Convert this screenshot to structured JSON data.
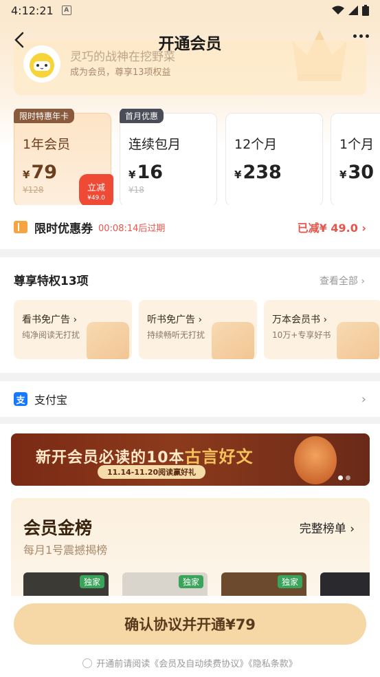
{
  "status_bar": {
    "time": "4:12:21",
    "indicator": "A"
  },
  "header": {
    "title": "开通会员"
  },
  "user": {
    "name": "灵巧的战神在挖野菜",
    "subtitle": "成为会员，尊享13项权益"
  },
  "plans": [
    {
      "tag": "限时特惠年卡",
      "name": "1年会员",
      "currency": "¥",
      "price": "79",
      "original": "¥128",
      "selected": true,
      "badge_line1": "立减",
      "badge_line2": "¥49.0"
    },
    {
      "tag": "首月优惠",
      "name": "连续包月",
      "currency": "¥",
      "price": "16",
      "original": "¥18",
      "selected": false
    },
    {
      "tag": "",
      "name": "12个月",
      "currency": "¥",
      "price": "238",
      "original": "",
      "selected": false
    },
    {
      "tag": "",
      "name": "1个月",
      "currency": "¥",
      "price": "30",
      "original": "",
      "selected": false
    }
  ],
  "coupon": {
    "label": "限时优惠券",
    "timer": "00:08:14后过期",
    "saved": "已减¥ 49.0"
  },
  "perks": {
    "title": "尊享特权13项",
    "view_all": "查看全部",
    "items": [
      {
        "title": "看书免广告",
        "subtitle": "纯净阅读无打扰",
        "icon": "ad-free-icon"
      },
      {
        "title": "听书免广告",
        "subtitle": "持续畅听无打扰",
        "icon": "headphones-icon"
      },
      {
        "title": "万本会员书",
        "subtitle": "10万+专享好书",
        "icon": "books-icon"
      }
    ]
  },
  "payment": {
    "icon_glyph": "支",
    "label": "支付宝"
  },
  "banner": {
    "title_a": "新开会员必读的10本",
    "title_b": "古言好文",
    "subtitle": "11.14-11.20阅读赢好礼"
  },
  "ranking": {
    "title": "会员金榜",
    "subtitle": "每月1号震撼揭榜",
    "more": "完整榜单",
    "covers": [
      {
        "badge": "独家",
        "color": "#3b3a35"
      },
      {
        "badge": "独家",
        "color": "#d9d4cc"
      },
      {
        "badge": "独家",
        "color": "#6b4a2e"
      },
      {
        "badge": "",
        "color": "#2a2a2e"
      }
    ]
  },
  "cta": {
    "label": "确认协议并开通¥79"
  },
  "agreement": {
    "text": "开通前请阅读《会员及自动续费协议》《隐私条款》"
  },
  "colors": {
    "accent": "#e9544a",
    "gold": "#f6d7a6",
    "brand_brown": "#6b3e1e"
  }
}
